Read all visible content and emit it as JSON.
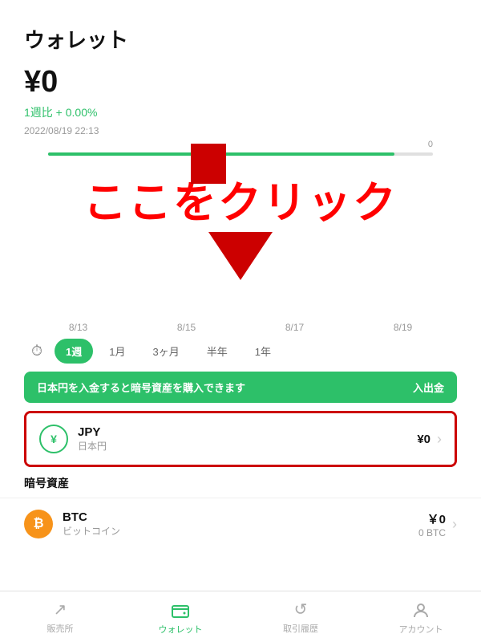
{
  "header": {
    "title": "ウォレット",
    "balance": "¥0",
    "weekly_change": "1週比 + 0.00%",
    "timestamp": "2022/08/19 22:13"
  },
  "progress": {
    "label": "0"
  },
  "click_here": "ここをクリック",
  "chart": {
    "dates": [
      "8/13",
      "8/15",
      "8/17",
      "8/19"
    ]
  },
  "periods": [
    {
      "label": "1週",
      "active": true
    },
    {
      "label": "1月",
      "active": false
    },
    {
      "label": "3ヶ月",
      "active": false
    },
    {
      "label": "半年",
      "active": false
    },
    {
      "label": "1年",
      "active": false
    }
  ],
  "deposit_banner": {
    "text": "日本円を入金すると暗号資産を購入できます",
    "action": "入出金"
  },
  "jpy_row": {
    "code": "JPY",
    "name": "日本円",
    "amount": "¥0",
    "icon": "¥"
  },
  "crypto_section": {
    "label": "暗号資産",
    "items": [
      {
        "code": "BTC",
        "name": "ビットコイン",
        "amount": "￥0",
        "sub": "0 BTC"
      }
    ]
  },
  "bottom_nav": [
    {
      "label": "販売所",
      "icon": "↗",
      "active": false
    },
    {
      "label": "ウォレット",
      "icon": "👜",
      "active": true
    },
    {
      "label": "取引履歴",
      "icon": "↺",
      "active": false
    },
    {
      "label": "アカウント",
      "icon": "👤",
      "active": false
    }
  ]
}
